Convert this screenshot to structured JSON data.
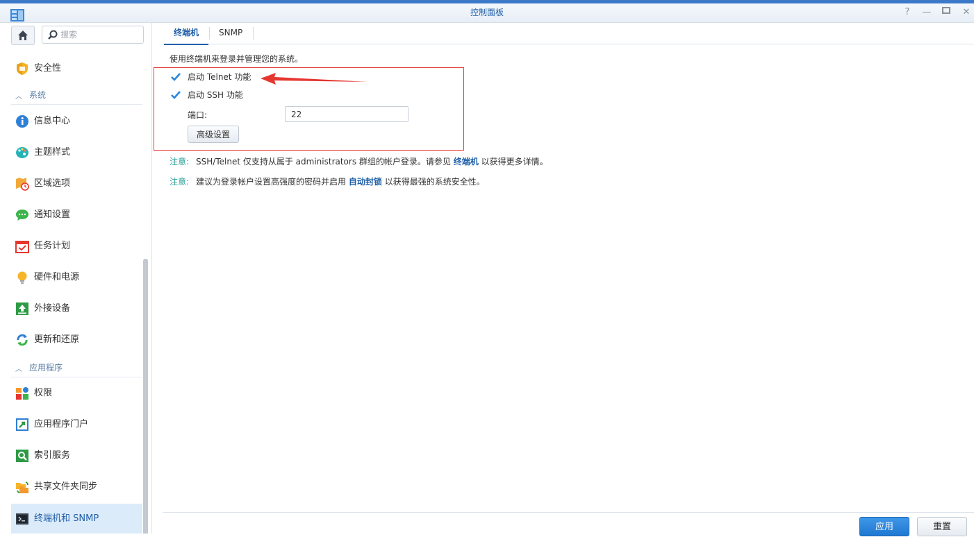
{
  "window": {
    "title": "控制面板",
    "controls": [
      "help-icon",
      "minimize-icon",
      "maximize-icon",
      "close-icon"
    ]
  },
  "sidebar": {
    "search_placeholder": "搜索",
    "items": [
      {
        "label": "安全性",
        "icon": "shield-icon"
      },
      {
        "section": "系统"
      },
      {
        "label": "信息中心",
        "icon": "info-icon"
      },
      {
        "label": "主题样式",
        "icon": "palette-icon"
      },
      {
        "label": "区域选项",
        "icon": "region-clock-icon"
      },
      {
        "label": "通知设置",
        "icon": "chat-bubble-icon"
      },
      {
        "label": "任务计划",
        "icon": "calendar-check-icon"
      },
      {
        "label": "硬件和电源",
        "icon": "lightbulb-icon"
      },
      {
        "label": "外接设备",
        "icon": "upload-icon"
      },
      {
        "label": "更新和还原",
        "icon": "refresh-icon"
      },
      {
        "section": "应用程序"
      },
      {
        "label": "权限",
        "icon": "blocks-icon"
      },
      {
        "label": "应用程序门户",
        "icon": "portal-arrow-icon"
      },
      {
        "label": "索引服务",
        "icon": "search-doc-icon"
      },
      {
        "label": "共享文件夹同步",
        "icon": "folder-sync-icon"
      },
      {
        "label": "终端机和 SNMP",
        "icon": "terminal-icon",
        "active": true
      }
    ]
  },
  "tabs": [
    {
      "label": "终端机",
      "active": true
    },
    {
      "label": "SNMP",
      "active": false
    }
  ],
  "main": {
    "description": "使用终端机来登录并管理您的系统。",
    "telnet_label": "启动 Telnet 功能",
    "telnet_checked": true,
    "ssh_label": "启动 SSH 功能",
    "ssh_checked": true,
    "port_label": "端口:",
    "port_value": "22",
    "advanced_button": "高级设置",
    "note1": {
      "label": "注意:",
      "text_before": "SSH/Telnet 仅支持从属于 administrators 群组的帐户登录。请参见",
      "link": "终端机",
      "text_after": "以获得更多详情。"
    },
    "note2": {
      "label": "注意:",
      "text_before": "建议为登录帐户设置高强度的密码并启用",
      "link": "自动封锁",
      "text_after": "以获得最强的系统安全性。"
    }
  },
  "footer": {
    "apply": "应用",
    "reset": "重置"
  },
  "colors": {
    "accent": "#1f5fa8",
    "highlight_box": "#e5362f",
    "note_label": "#2aa197",
    "primary_button": "#2a86dc"
  }
}
